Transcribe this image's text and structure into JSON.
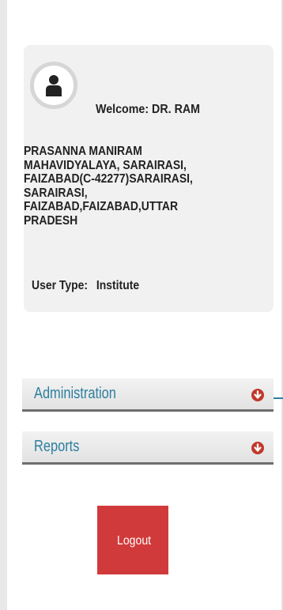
{
  "user_panel": {
    "welcome": "Welcome: DR. RAM",
    "address_lines": [
      "PRASANNA MANIRAM",
      "MAHAVIDYALAYA, SARAIRASI,",
      "FAIZABAD(C-42277)SARAIRASI,",
      "SARAIRASI,",
      "FAIZABAD,FAIZABAD,UTTAR",
      "PRADESH"
    ],
    "user_type_label": "User Type:",
    "user_type_value": "Institute",
    "avatar_icon": "user-icon"
  },
  "menu": {
    "items": [
      {
        "label": "Administration",
        "icon": "arrow-down-circle-icon"
      },
      {
        "label": "Reports",
        "icon": "arrow-down-circle-icon"
      }
    ]
  },
  "logout": {
    "label": "Logout"
  },
  "colors": {
    "menu_text": "#2c7f9f",
    "logout_bg": "#d13a3a",
    "arrow_icon": "#c0392b"
  }
}
